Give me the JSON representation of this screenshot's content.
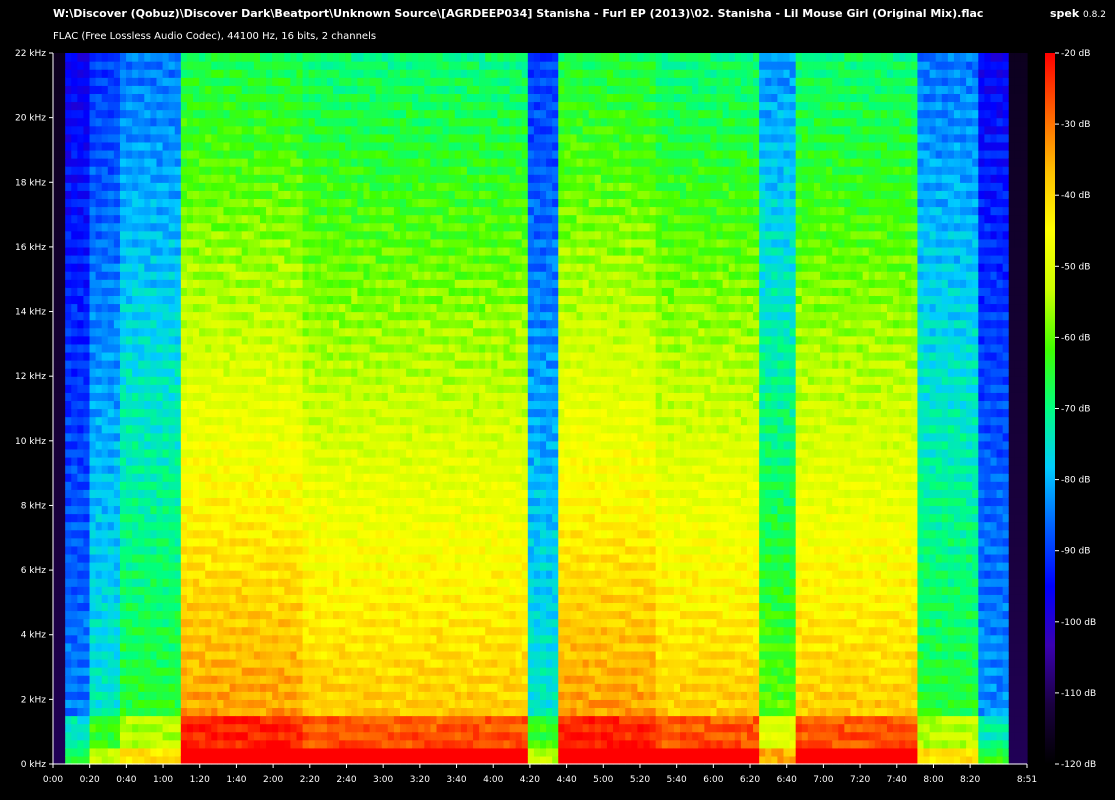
{
  "header": {
    "title": "W:\\Discover (Qobuz)\\Discover Dark\\Beatport\\Unknown Source\\[AGRDEEP034] Stanisha - Furl EP (2013)\\02. Stanisha - Lil Mouse Girl (Original Mix).flac",
    "subtitle": "FLAC (Free Lossless Audio Codec), 44100 Hz, 16 bits, 2 channels",
    "app_name": "spek",
    "app_version": "0.8.2"
  },
  "chart_data": {
    "type": "heatmap",
    "x_axis": {
      "range_seconds": [
        0,
        531
      ],
      "ticks": [
        {
          "label": "0:00",
          "t": 0
        },
        {
          "label": "0:20",
          "t": 20
        },
        {
          "label": "0:40",
          "t": 40
        },
        {
          "label": "1:00",
          "t": 60
        },
        {
          "label": "1:20",
          "t": 80
        },
        {
          "label": "1:40",
          "t": 100
        },
        {
          "label": "2:00",
          "t": 120
        },
        {
          "label": "2:20",
          "t": 140
        },
        {
          "label": "2:40",
          "t": 160
        },
        {
          "label": "3:00",
          "t": 180
        },
        {
          "label": "3:20",
          "t": 200
        },
        {
          "label": "3:40",
          "t": 220
        },
        {
          "label": "4:00",
          "t": 240
        },
        {
          "label": "4:20",
          "t": 260
        },
        {
          "label": "4:40",
          "t": 280
        },
        {
          "label": "5:00",
          "t": 300
        },
        {
          "label": "5:20",
          "t": 320
        },
        {
          "label": "5:40",
          "t": 340
        },
        {
          "label": "6:00",
          "t": 360
        },
        {
          "label": "6:20",
          "t": 380
        },
        {
          "label": "6:40",
          "t": 400
        },
        {
          "label": "7:00",
          "t": 420
        },
        {
          "label": "7:20",
          "t": 440
        },
        {
          "label": "7:40",
          "t": 460
        },
        {
          "label": "8:00",
          "t": 480
        },
        {
          "label": "8:20",
          "t": 500
        },
        {
          "label": "8:51",
          "t": 531
        }
      ]
    },
    "y_axis": {
      "range_khz": [
        0,
        22
      ],
      "ticks": [
        {
          "label": "0 kHz",
          "v": 0
        },
        {
          "label": "2 kHz",
          "v": 2
        },
        {
          "label": "4 kHz",
          "v": 4
        },
        {
          "label": "6 kHz",
          "v": 6
        },
        {
          "label": "8 kHz",
          "v": 8
        },
        {
          "label": "10 kHz",
          "v": 10
        },
        {
          "label": "12 kHz",
          "v": 12
        },
        {
          "label": "14 kHz",
          "v": 14
        },
        {
          "label": "16 kHz",
          "v": 16
        },
        {
          "label": "18 kHz",
          "v": 18
        },
        {
          "label": "20 kHz",
          "v": 20
        },
        {
          "label": "22 kHz",
          "v": 22
        }
      ]
    },
    "color_scale": {
      "range_db": [
        -120,
        -20
      ],
      "ticks": [
        {
          "label": "-20 dB",
          "v": -20
        },
        {
          "label": "-30 dB",
          "v": -30
        },
        {
          "label": "-40 dB",
          "v": -40
        },
        {
          "label": "-50 dB",
          "v": -50
        },
        {
          "label": "-60 dB",
          "v": -60
        },
        {
          "label": "-70 dB",
          "v": -70
        },
        {
          "label": "-80 dB",
          "v": -80
        },
        {
          "label": "-90 dB",
          "v": -90
        },
        {
          "label": "-100 dB",
          "v": -100
        },
        {
          "label": "-110 dB",
          "v": -110
        },
        {
          "label": "-120 dB",
          "v": -120
        }
      ],
      "gradient": [
        "#000000",
        "#1a0040",
        "#3a00b0",
        "#0000ff",
        "#0060ff",
        "#00ccff",
        "#00ff80",
        "#40ff00",
        "#ccff00",
        "#ffff00",
        "#ffc000",
        "#ff6000",
        "#ff0000"
      ]
    },
    "segments": [
      {
        "start": 0,
        "end": 5,
        "level": 0.05
      },
      {
        "start": 5,
        "end": 20,
        "level": 0.33
      },
      {
        "start": 20,
        "end": 35,
        "level": 0.45
      },
      {
        "start": 35,
        "end": 70,
        "level": 0.55
      },
      {
        "start": 70,
        "end": 135,
        "level": 0.9
      },
      {
        "start": 135,
        "end": 260,
        "level": 0.85
      },
      {
        "start": 260,
        "end": 275,
        "level": 0.45
      },
      {
        "start": 275,
        "end": 330,
        "level": 0.9
      },
      {
        "start": 330,
        "end": 385,
        "level": 0.85
      },
      {
        "start": 385,
        "end": 405,
        "level": 0.6
      },
      {
        "start": 405,
        "end": 470,
        "level": 0.85
      },
      {
        "start": 470,
        "end": 505,
        "level": 0.55
      },
      {
        "start": 505,
        "end": 522,
        "level": 0.35
      },
      {
        "start": 522,
        "end": 531,
        "level": 0.05
      }
    ]
  }
}
